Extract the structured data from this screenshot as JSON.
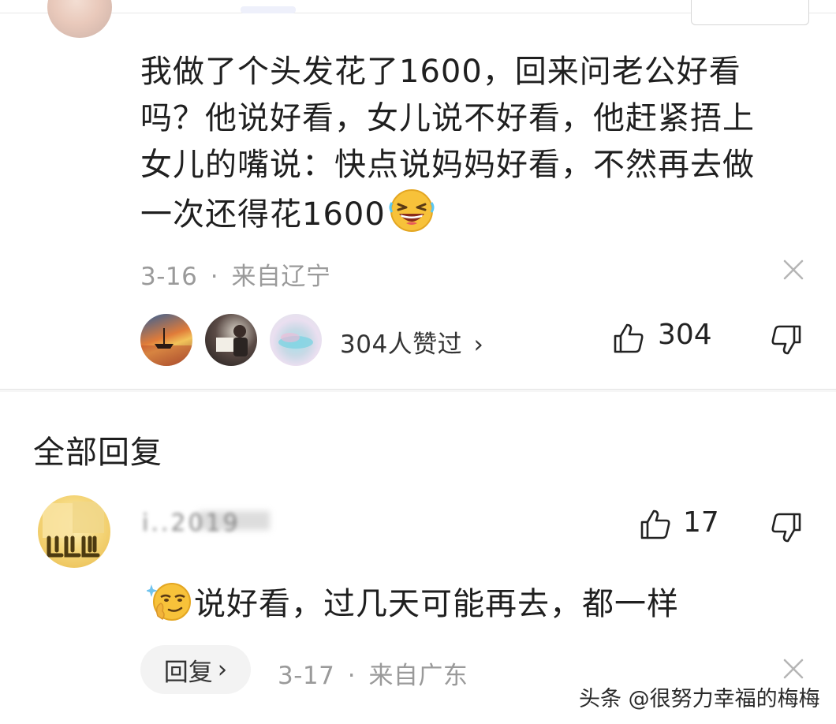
{
  "main_comment": {
    "lines": [
      "我做了个头发花了1600，回来问老公好看",
      "吗？他说好看，女儿说不好看，他赶紧捂上",
      "女儿的嘴说：快点说妈妈好看，不然再去做",
      "一次还得花1600"
    ],
    "emoji": "laughing-emoji",
    "date": "3-16",
    "separator": "·",
    "location": "来自辽宁",
    "liked_by_text": "304人赞过",
    "liked_by_chevron": "›",
    "like_count": "304"
  },
  "replies_section": {
    "title": "全部回复"
  },
  "reply": {
    "username": "i..2019",
    "like_count": "17",
    "emoji": "smirk-emoji",
    "text": "说好看，过几天可能再去，都一样",
    "reply_button_label": "回复",
    "reply_button_chevron": "›",
    "date": "3-17",
    "separator": "·",
    "location": "来自广东"
  },
  "watermark": "头条 @很努力幸福的梅梅",
  "icons": {
    "like": "thumbs-up-icon",
    "dislike": "thumbs-down-icon",
    "close": "close-icon"
  },
  "colors": {
    "meta_text": "#9a9a9a",
    "body_text": "#1f1f1f",
    "reply_button_bg": "#f3f3f3"
  }
}
